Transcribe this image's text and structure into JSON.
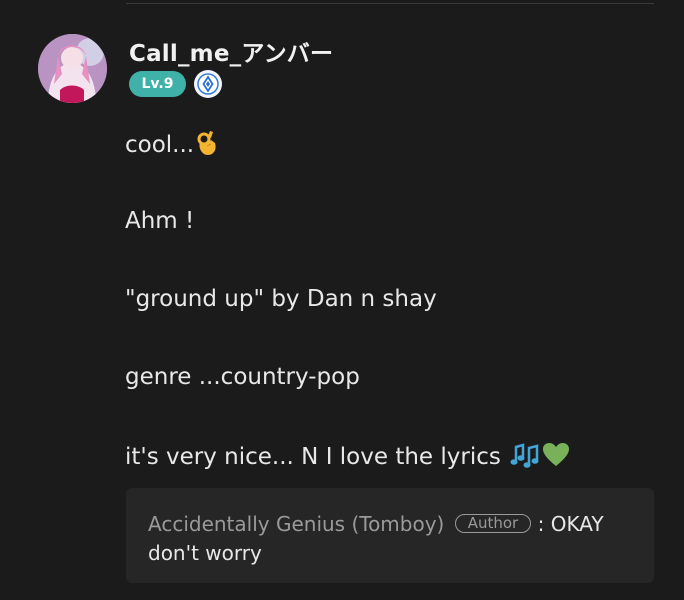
{
  "comment": {
    "username": "Call_me_アンバー",
    "level": "Lv.9",
    "badge_icon": "diamond-badge-icon",
    "lines": [
      "cool...",
      "Ahm !",
      "\"ground up\" by Dan n shay",
      "genre ...country-pop",
      "it's very nice... N I love the lyrics"
    ],
    "emojis": {
      "line1": "ok-hand-emoji",
      "line5": [
        "musical-notes-emoji",
        "green-heart-emoji"
      ]
    }
  },
  "reply": {
    "author": "Accidentally Genius (Tomboy)",
    "author_tag": "Author",
    "separator": ":",
    "text": "OKAY don't worry"
  },
  "colors": {
    "background": "#1b1b1b",
    "level_badge": "#3fb1a8",
    "reply_box": "#262626",
    "muted_text": "#9a9a9a"
  }
}
